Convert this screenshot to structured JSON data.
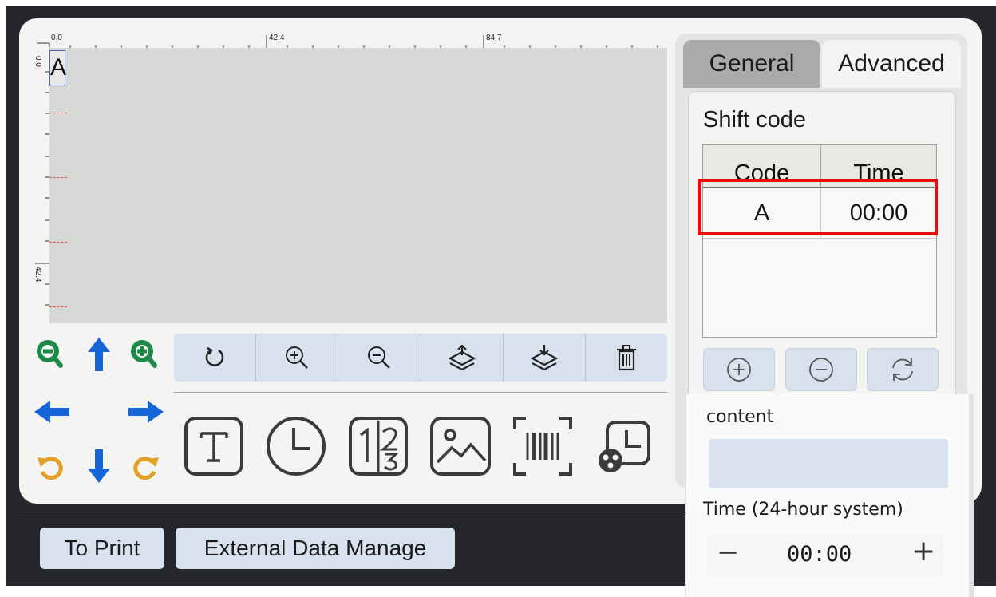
{
  "ruler": {
    "top_labels": [
      "0.0",
      "42.4",
      "84.7"
    ],
    "left_labels": [
      "0.0",
      "42.4"
    ]
  },
  "canvas": {
    "selected_item_text": "A"
  },
  "nav": {
    "zoom_out_icon": "zoom-out-icon",
    "up_icon": "arrow-up-icon",
    "zoom_in_icon": "zoom-in-icon",
    "left_icon": "arrow-left-icon",
    "right_icon": "arrow-right-icon",
    "rotate_ccw_icon": "rotate-ccw-icon",
    "down_icon": "arrow-down-icon",
    "rotate_cw_icon": "rotate-cw-icon"
  },
  "toolbar": [
    "reset-rotation-icon",
    "zoom-in-icon",
    "zoom-out-icon",
    "layer-up-icon",
    "layer-down-icon",
    "trash-icon"
  ],
  "insert_tools": [
    "text-icon",
    "clock-icon",
    "counter-icon",
    "image-icon",
    "barcode-icon",
    "shift-code-icon"
  ],
  "bottom": {
    "print_label": "To Print",
    "external_label": "External Data Manage"
  },
  "panel": {
    "tabs": [
      "General",
      "Advanced"
    ],
    "active_tab": "Advanced",
    "section_title": "Shift code",
    "table": {
      "columns": [
        "Code",
        "Time"
      ],
      "rows": [
        [
          "A",
          "00:00"
        ]
      ]
    },
    "action_icons": [
      "add-circle-icon",
      "remove-circle-icon",
      "refresh-icon"
    ]
  },
  "popup": {
    "content_label": "content",
    "content_value": "",
    "time_label": "Time (24-hour system)",
    "time_value": "00:00",
    "minus_label": "−",
    "plus_label": "+"
  },
  "colors": {
    "background": "#24262c",
    "card": "#f4f5f3",
    "canvas": "#d5d8d4",
    "button": "#d8e2ee",
    "nav_green": "#1d8a4a",
    "nav_blue": "#1565d8",
    "nav_orange": "#e0a126",
    "highlight_red": "#ec0c0c"
  }
}
